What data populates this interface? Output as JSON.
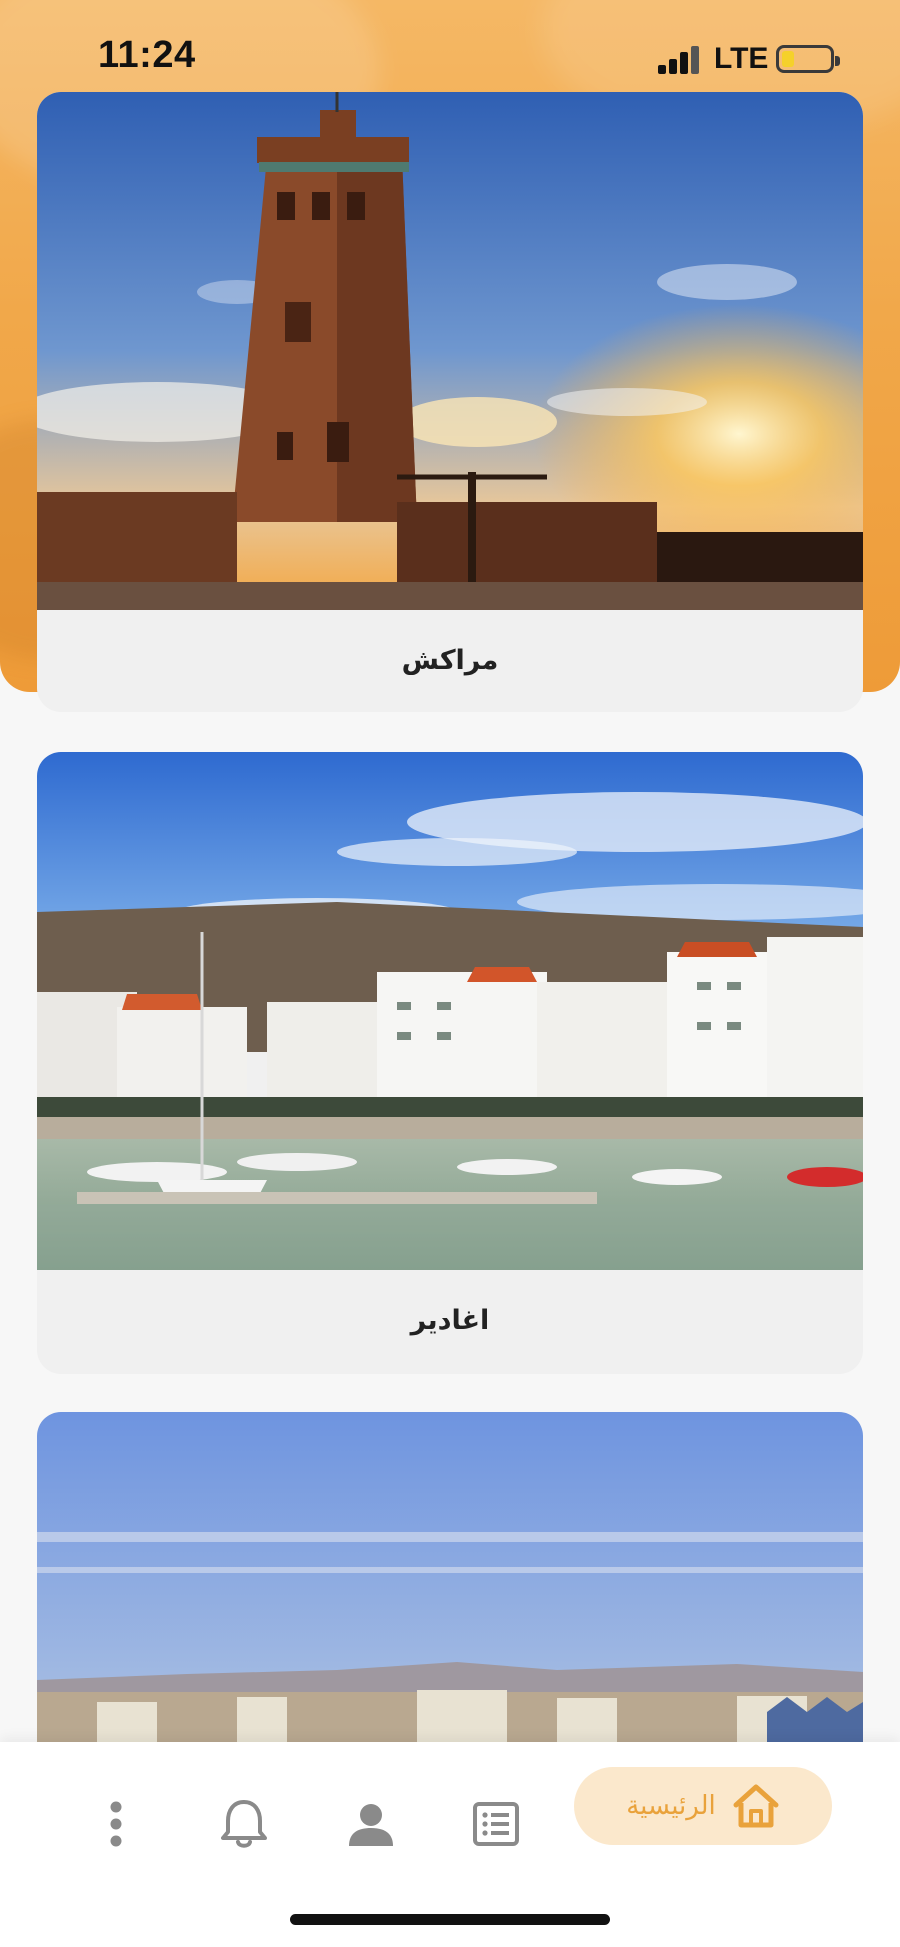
{
  "status_bar": {
    "time": "11:24",
    "network": "LTE",
    "battery_level": 0.25
  },
  "cards": [
    {
      "label": "مراكش",
      "image": "koutoubia-mosque-marrakech"
    },
    {
      "label": "اغادير",
      "image": "agadir-marina"
    },
    {
      "label": "",
      "image": "city-skyline"
    }
  ],
  "bottom_nav": {
    "items": [
      {
        "id": "more",
        "icon": "more-vertical-icon"
      },
      {
        "id": "notifications",
        "icon": "bell-icon"
      },
      {
        "id": "profile",
        "icon": "user-icon"
      },
      {
        "id": "list",
        "icon": "list-icon"
      },
      {
        "id": "home",
        "icon": "home-icon",
        "label": "الرئيسية",
        "active": true
      }
    ]
  },
  "colors": {
    "accent": "#e9a23b",
    "header": "#f1a84a",
    "active_pill": "#fbe8cc",
    "icon_gray": "#8a8a8a"
  }
}
